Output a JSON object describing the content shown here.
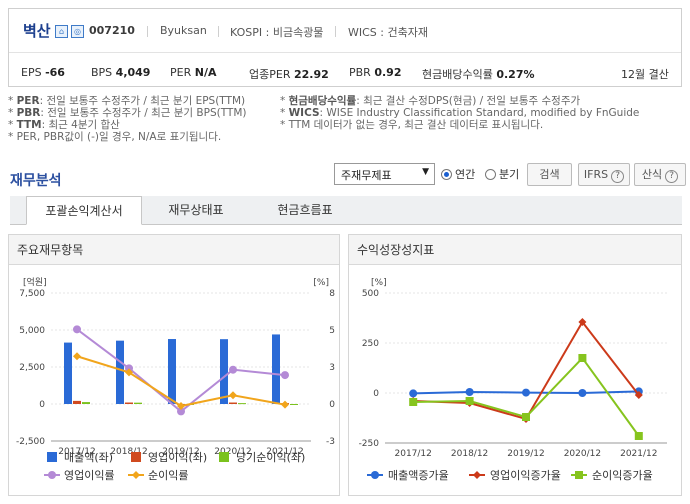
{
  "company": {
    "name": "벽산",
    "code": "007210",
    "english": "Byuksan",
    "market": "KOSPI : 비금속광물",
    "wics": "WICS : 건축자재"
  },
  "metrics": [
    {
      "label": "EPS",
      "value": "-66"
    },
    {
      "label": "BPS",
      "value": "4,049"
    },
    {
      "label": "PER",
      "value": "N/A"
    },
    {
      "label": "업종PER",
      "value": "22.92"
    },
    {
      "label": "PBR",
      "value": "0.92"
    },
    {
      "label": "현금배당수익률",
      "value": "0.27%"
    }
  ],
  "settle": "12월 결산",
  "notes": {
    "left": [
      {
        "key": "PER",
        "text": ": 전일 보통주 수정주가 / 최근 분기 EPS(TTM)"
      },
      {
        "key": "PBR",
        "text": ": 전일 보통주 수정주가 / 최근 분기 BPS(TTM)"
      },
      {
        "key": "TTM",
        "text": ": 최근 4분기 합산"
      },
      {
        "key": "",
        "text": "PER, PBR값이 (-)일 경우, N/A로 표기됩니다."
      }
    ],
    "right": [
      {
        "key": "현금배당수익률",
        "text": ": 최근 결산 수정DPS(현금) / 전일 보통주 수정주가"
      },
      {
        "key": "WICS",
        "text": ": WISE Industry Classification Standard, modified by FnGuide"
      },
      {
        "key": "",
        "text": "TTM 데이터가 없는 경우, 최근 결산 데이터로 표시됩니다."
      }
    ]
  },
  "section_title": "재무분석",
  "controls": {
    "select_value": "주재무제표",
    "radio_annual": "연간",
    "radio_quarter": "분기",
    "search": "검색",
    "ifrs": "IFRS",
    "formula": "산식"
  },
  "tabs": [
    "포괄손익계산서",
    "재무상태표",
    "현금흐름표"
  ],
  "left_panel": {
    "title": "주요재무항목"
  },
  "right_panel": {
    "title": "수익성장성지표"
  },
  "chart_data": [
    {
      "type": "bar",
      "title": "주요재무항목",
      "left_unit": "[억원]",
      "right_unit": "[%]",
      "categories": [
        "2017/12",
        "2018/12",
        "2019/12",
        "2020/12",
        "2021/12"
      ],
      "y_left_ticks": [
        "7,500",
        "5,000",
        "2,500",
        "0",
        "-2,500"
      ],
      "y_right_ticks": [
        "8",
        "5",
        "3",
        "0",
        "-3"
      ],
      "ylim_left": [
        -2500,
        7500
      ],
      "ylim_right": [
        -3,
        8
      ],
      "colors": {
        "revenue": "#2a6ad6",
        "op": "#d04a1f",
        "net": "#7bc21e",
        "opm": "#b48ad6",
        "npm": "#f1a51c"
      },
      "series": [
        {
          "name": "매출액(좌)",
          "axis": "left",
          "kind": "bar",
          "values": [
            4150,
            4280,
            4390,
            4380,
            4700
          ]
        },
        {
          "name": "영업이익(좌)",
          "axis": "left",
          "kind": "bar",
          "values": [
            210,
            100,
            -45,
            100,
            60
          ]
        },
        {
          "name": "당기순이익(좌)",
          "axis": "left",
          "kind": "bar",
          "values": [
            130,
            90,
            -50,
            60,
            -30
          ]
        },
        {
          "name": "영업이익률",
          "axis": "right",
          "kind": "line",
          "values": [
            5.3,
            2.4,
            -0.8,
            2.3,
            1.9
          ]
        },
        {
          "name": "순이익률",
          "axis": "right",
          "kind": "line",
          "values": [
            3.3,
            2.1,
            -0.4,
            0.4,
            -0.3
          ]
        }
      ]
    },
    {
      "type": "line",
      "title": "수익성장성지표",
      "unit": "[%]",
      "categories": [
        "2017/12",
        "2018/12",
        "2019/12",
        "2020/12",
        "2021/12"
      ],
      "y_ticks": [
        "500",
        "250",
        "0",
        "-250"
      ],
      "ylim": [
        -250,
        500
      ],
      "colors": {
        "rev": "#2a6ad6",
        "op": "#cc3a1a",
        "net": "#86c41e"
      },
      "series": [
        {
          "name": "매출액증가율",
          "values": [
            -2,
            5,
            2,
            0,
            8
          ]
        },
        {
          "name": "영업이익증가율",
          "values": [
            -40,
            -50,
            -130,
            355,
            -10
          ]
        },
        {
          "name": "순이익증가율",
          "values": [
            -45,
            -40,
            -120,
            175,
            -215
          ]
        }
      ]
    }
  ]
}
